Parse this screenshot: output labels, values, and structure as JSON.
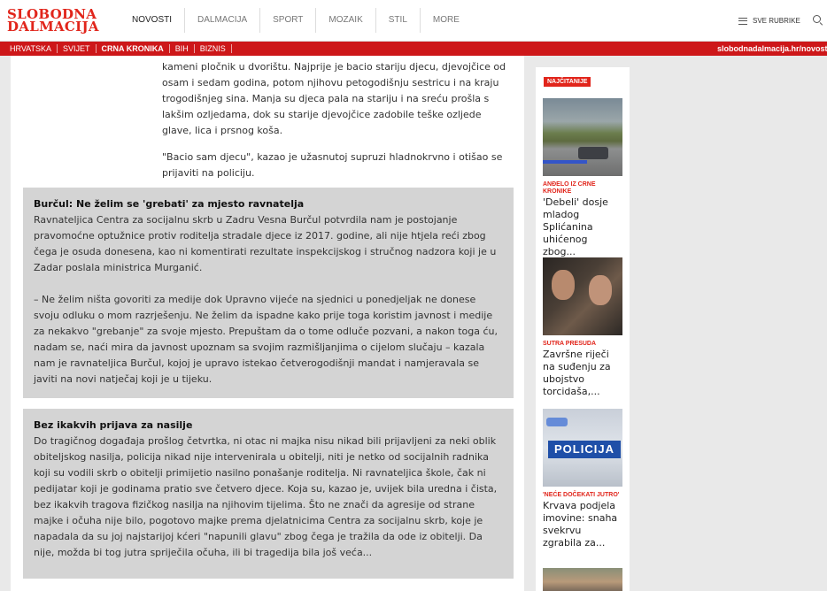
{
  "header": {
    "logo_line1": "SLOBODNA",
    "logo_line2": "DALMACIJA",
    "nav": [
      "NOVOSTI",
      "DALMACIJA",
      "SPORT",
      "MOZAIK",
      "STIL",
      "MORE"
    ],
    "rubrike": "SVE RUBRIKE"
  },
  "subbar": {
    "items": [
      "HRVATSKA",
      "SVIJET",
      "CRNA KRONIKA",
      "BIH",
      "BIZNIS"
    ],
    "site": "slobodnadalmacija.hr/novosti"
  },
  "article": {
    "intro": [
      "kameni pločnik u dvorištu. Najprije je bacio stariju djecu, djevojčice od osam i sedam godina, potom njihovu petogodišnju sestricu i na kraju trogodišnjeg sina. Manja su djeca pala na stariju i na sreću prošla s lakšim ozljedama, dok su starije djevojčice zadobile teške ozljede glave, lica i prsnog koša.",
      "\"Bacio sam djecu\", kazao je užasnutoj supruzi hladnokrvno i otišao se prijaviti na policiju."
    ],
    "box1": {
      "title": "Burčul: Ne želim se 'grebati' za mjesto ravnatelja",
      "p1": "Ravnateljica Centra za socijalnu skrb u Zadru Vesna Burčul potvrdila nam je postojanje pravomoćne optužnice protiv roditelja stradale djece iz 2017. godine, ali nije htjela reći zbog čega je osuda donesena, kao ni komentirati rezultate inspekcijskog i stručnog nadzora koji je u Zadar poslala ministrica Murganić.",
      "p2": "– Ne želim ništa govoriti za medije dok Upravno vijeće na sjednici u ponedjeljak ne donese svoju odluku o mom razrješenju. Ne želim da ispadne kako prije toga koristim javnost i medije za nekakvo \"grebanje\" za svoje mjesto. Prepuštam da o tome odluče pozvani, a nakon toga ću, nadam se, naći mira da javnost upoznam sa svojim razmišljanjima o cijelom slučaju – kazala nam je ravnateljica Burčul, kojoj je upravo istekao četverogodišnji mandat i namjeravala se javiti na novi natječaj koji je u tijeku."
    },
    "box2": {
      "title": "Bez ikakvih prijava za nasilje",
      "p1": "Do tragičnog događaja prošlog četvrtka, ni otac ni majka nisu nikad bili prijavljeni za neki oblik obiteljskog nasilja, policija nikad nije intervenirala u obitelji, niti je netko od socijalnih radnika koji su vodili skrb o obitelji primijetio nasilno ponašanje roditelja. Ni ravnateljica škole, čak ni pedijatar koji je godinama pratio sve četvero djece. Koja su, kazao je, uvijek bila uredna i čista, bez ikakvih tragova fizičkog nasilja na njihovim tijelima. Što ne znači da agresije od strane majke i očuha nije bilo, pogotovo majke prema djelatnicima Centra za socijalnu skrb, koje je napadala da su joj najstarijoj kćeri \"napunili glavu\" zbog čega je tražila da ode iz obitelji. Da nije, možda bi tog jutra spriječila očuha, ili bi tragedija bila još veća..."
    }
  },
  "sidebar": {
    "badge": "NAJČITANIJE",
    "cards": [
      {
        "kicker": "ANĐELO IZ CRNE KRONIKE",
        "title": "'Debeli' dosje mladog Splićanina uhićenog zbog..."
      },
      {
        "kicker": "SUTRA PRESUDA",
        "title": "Završne riječi na suđenju za ubojstvo torcidaša,..."
      },
      {
        "kicker": "'NEĆE DOČEKATI JUTRO'",
        "title": "Krvava podjela imovine: snaha svekrvu zgrabila za..."
      }
    ],
    "police_sign": "POLICIJA"
  }
}
